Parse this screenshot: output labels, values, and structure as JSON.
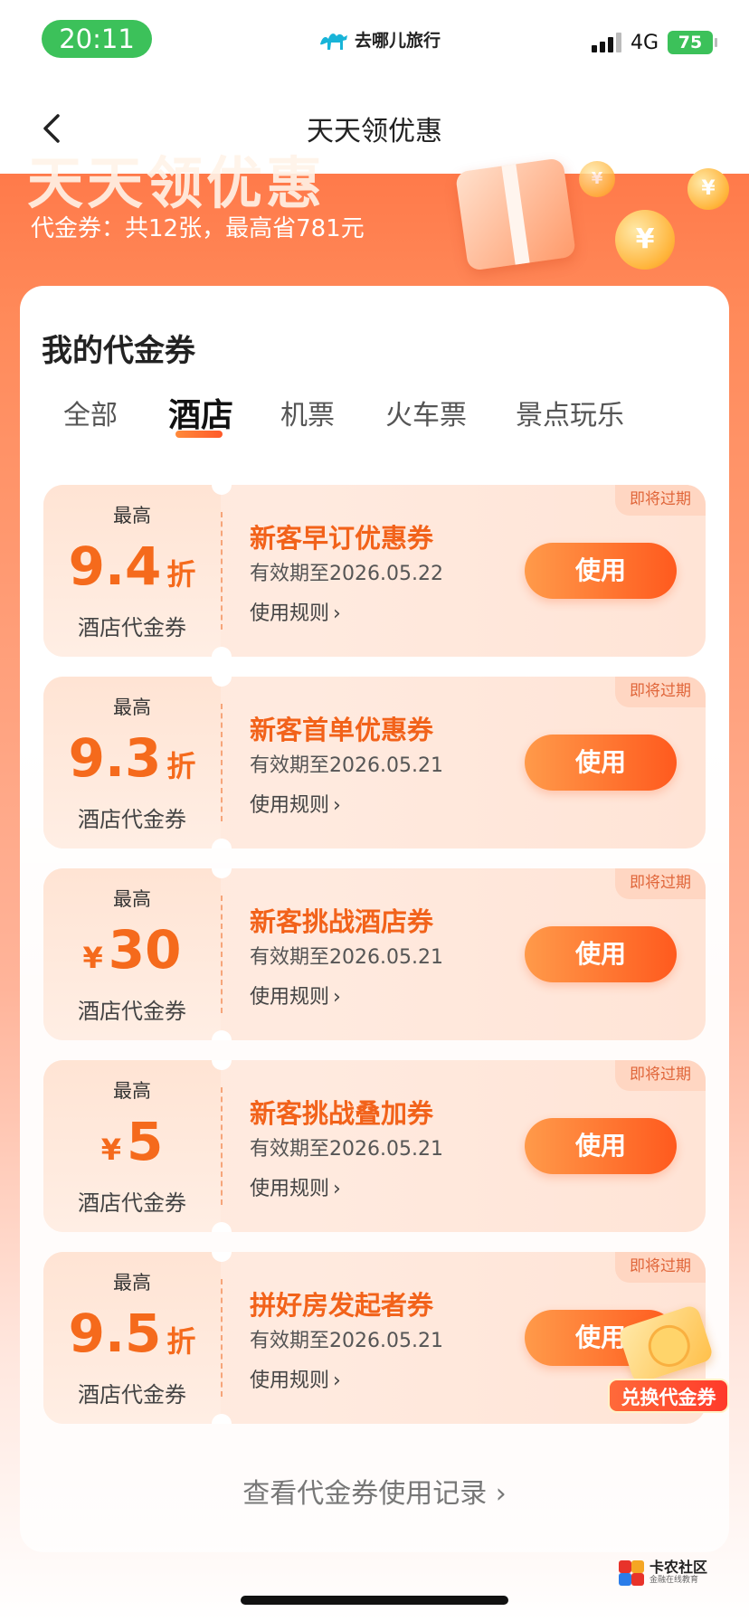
{
  "status_bar": {
    "time": "20:11",
    "app_name": "去哪儿旅行",
    "network": "4G",
    "battery": "75"
  },
  "nav": {
    "title": "天天领优惠"
  },
  "banner": {
    "headline": "天天领优惠",
    "subtitle": "代金券：共12张，最高省781元"
  },
  "section": {
    "title": "我的代金券"
  },
  "tabs": [
    {
      "label": "全部"
    },
    {
      "label": "酒店"
    },
    {
      "label": "机票"
    },
    {
      "label": "火车票"
    },
    {
      "label": "景点玩乐"
    }
  ],
  "active_tab": "酒店",
  "coupons": [
    {
      "max_label": "最高",
      "prefix": "",
      "value": "9.4",
      "unit": "折",
      "type_label": "酒店代金券",
      "name": "新客早订优惠券",
      "expiry": "有效期至2026.05.22",
      "rules": "使用规则",
      "tag": "即将过期",
      "button": "使用"
    },
    {
      "max_label": "最高",
      "prefix": "",
      "value": "9.3",
      "unit": "折",
      "type_label": "酒店代金券",
      "name": "新客首单优惠券",
      "expiry": "有效期至2026.05.21",
      "rules": "使用规则",
      "tag": "即将过期",
      "button": "使用"
    },
    {
      "max_label": "最高",
      "prefix": "¥",
      "value": "30",
      "unit": "",
      "type_label": "酒店代金券",
      "name": "新客挑战酒店券",
      "expiry": "有效期至2026.05.21",
      "rules": "使用规则",
      "tag": "即将过期",
      "button": "使用"
    },
    {
      "max_label": "最高",
      "prefix": "¥",
      "value": "5",
      "unit": "",
      "type_label": "酒店代金券",
      "name": "新客挑战叠加券",
      "expiry": "有效期至2026.05.21",
      "rules": "使用规则",
      "tag": "即将过期",
      "button": "使用"
    },
    {
      "max_label": "最高",
      "prefix": "",
      "value": "9.5",
      "unit": "折",
      "type_label": "酒店代金券",
      "name": "拼好房发起者券",
      "expiry": "有效期至2026.05.21",
      "rules": "使用规则",
      "tag": "即将过期",
      "button": "使用"
    }
  ],
  "history_link": "查看代金券使用记录",
  "exchange_float": "兑换代金券",
  "watermark": {
    "main": "卡农社区",
    "sub": "金融在线教育"
  },
  "colors": {
    "accent": "#f56a1c",
    "status_green": "#3cc15a",
    "button_gradient_start": "#ff9a4a",
    "button_gradient_end": "#ff5a1e"
  },
  "icons": {
    "back": "chevron-left-icon",
    "rules": "chevron-right-icon",
    "history": "chevron-right-icon",
    "logo": "camel-logo-icon"
  }
}
